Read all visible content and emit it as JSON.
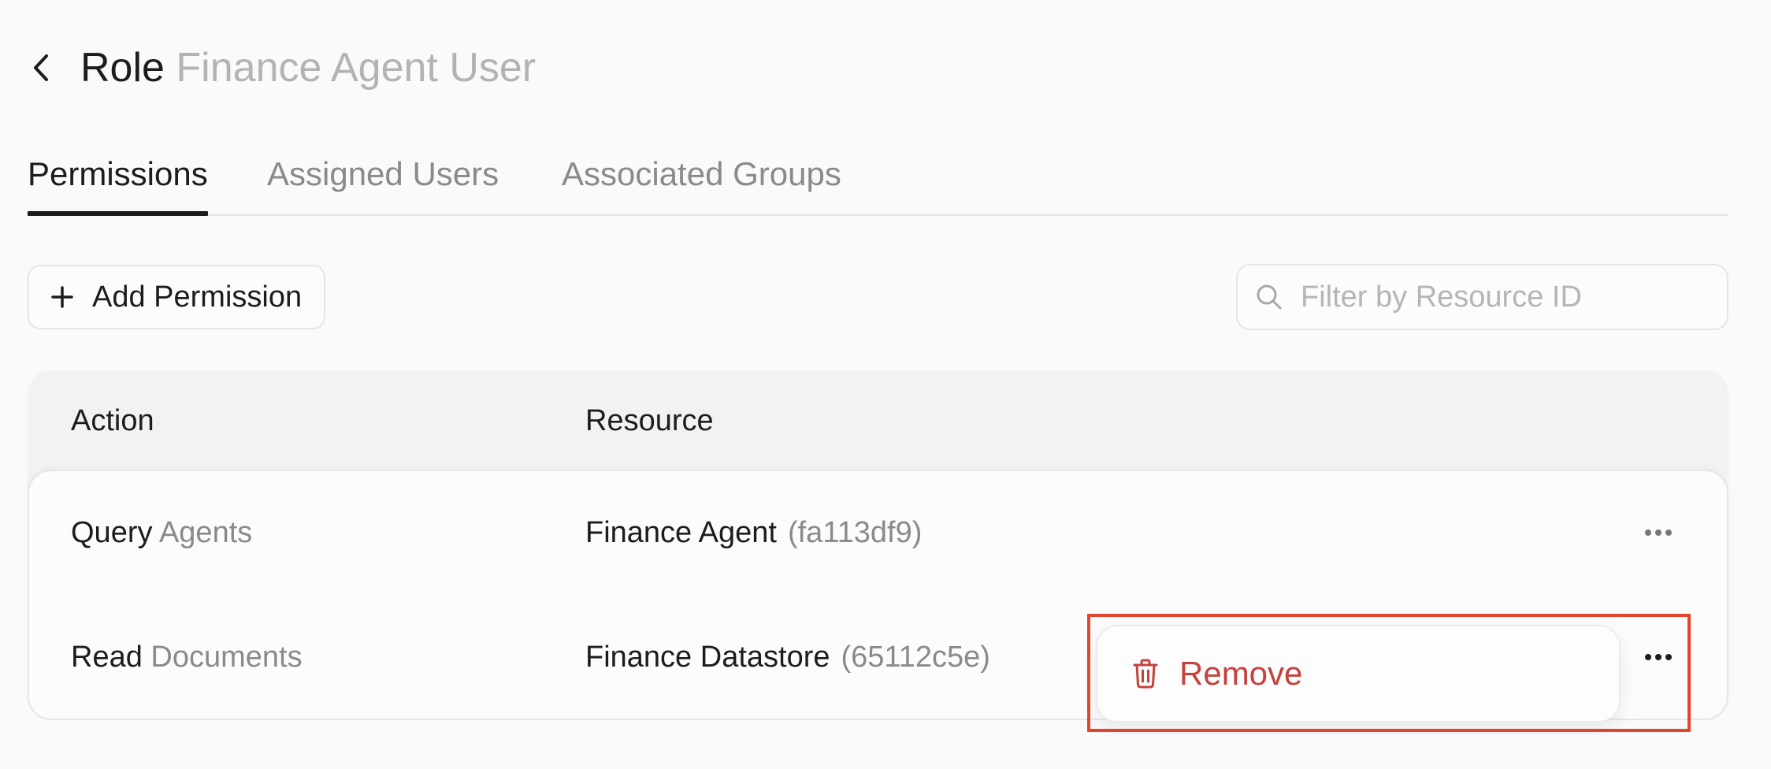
{
  "header": {
    "back_icon": "chevron-left-icon",
    "title_prefix": "Role",
    "title_name": "Finance Agent User"
  },
  "tabs": [
    {
      "label": "Permissions",
      "active": true
    },
    {
      "label": "Assigned Users",
      "active": false
    },
    {
      "label": "Associated Groups",
      "active": false
    }
  ],
  "toolbar": {
    "add_permission_label": "Add Permission",
    "add_icon": "plus-icon",
    "search_icon": "search-icon",
    "search_placeholder": "Filter by Resource ID",
    "search_value": ""
  },
  "table": {
    "columns": [
      "Action",
      "Resource"
    ],
    "rows": [
      {
        "verb": "Query",
        "object": "Agents",
        "resource": "Finance Agent",
        "resource_id": "(fa113df9)"
      },
      {
        "verb": "Read",
        "object": "Documents",
        "resource": "Finance Datastore",
        "resource_id": "(65112c5e)"
      }
    ],
    "row_menu_icon": "more-horizontal-icon"
  },
  "menu": {
    "item_label": "Remove",
    "item_icon": "trash-icon",
    "item_color": "#c4413d"
  },
  "colors": {
    "background": "#fafafa",
    "text": "#1c1c1c",
    "muted": "#8a8a8a",
    "danger": "#c4413d",
    "highlight": "#e0462e"
  }
}
